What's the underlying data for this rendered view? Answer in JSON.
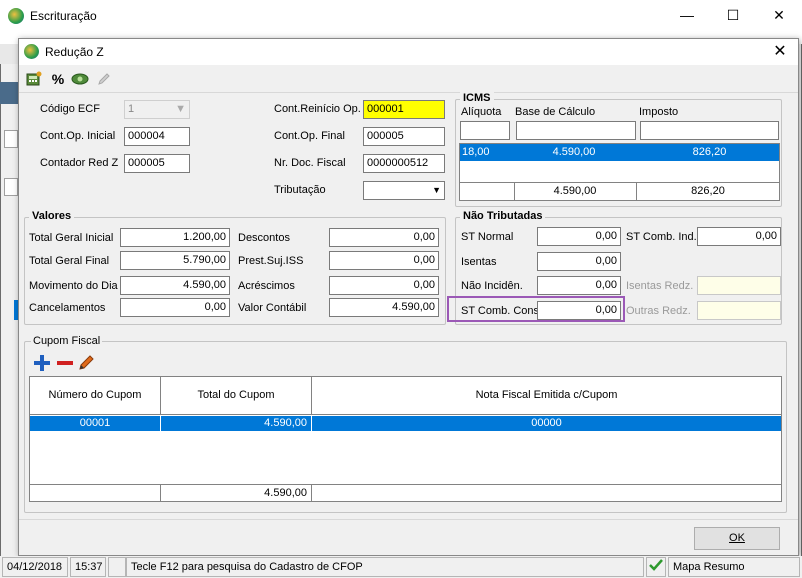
{
  "app": {
    "title": "Escrituração"
  },
  "dialog": {
    "title": "Redução Z"
  },
  "toolbar": {
    "percent_label": "%"
  },
  "header": {
    "codigo_ecf_label": "Código ECF",
    "codigo_ecf_value": "1",
    "cont_op_inicial_label": "Cont.Op. Inicial",
    "cont_op_inicial_value": "000004",
    "contador_red_z_label": "Contador Red Z",
    "contador_red_z_value": "000005",
    "cont_reinicio_label": "Cont.Reinício Op.",
    "cont_reinicio_value": "000001",
    "cont_op_final_label": "Cont.Op. Final",
    "cont_op_final_value": "000005",
    "nr_doc_fiscal_label": "Nr. Doc. Fiscal",
    "nr_doc_fiscal_value": "0000000512",
    "tributacao_label": "Tributação",
    "tributacao_value": ""
  },
  "icms": {
    "title": "ICMS",
    "columns": [
      "Alíquota",
      "Base de Cálculo",
      "Imposto"
    ],
    "rows": [
      {
        "aliquota": "18,00",
        "base": "4.590,00",
        "imposto": "826,20"
      }
    ],
    "totals": {
      "base": "4.590,00",
      "imposto": "826,20"
    }
  },
  "valores": {
    "title": "Valores",
    "total_geral_inicial_label": "Total Geral Inicial",
    "total_geral_inicial_value": "1.200,00",
    "total_geral_final_label": "Total Geral Final",
    "total_geral_final_value": "5.790,00",
    "movimento_dia_label": "Movimento do Dia",
    "movimento_dia_value": "4.590,00",
    "cancelamentos_label": "Cancelamentos",
    "cancelamentos_value": "0,00",
    "descontos_label": "Descontos",
    "descontos_value": "0,00",
    "prest_suj_iss_label": "Prest.Suj.ISS",
    "prest_suj_iss_value": "0,00",
    "acrescimos_label": "Acréscimos",
    "acrescimos_value": "0,00",
    "valor_contabil_label": "Valor Contábil",
    "valor_contabil_value": "4.590,00"
  },
  "nao_tributadas": {
    "title": "Não Tributadas",
    "st_normal_label": "ST Normal",
    "st_normal_value": "0,00",
    "isentas_label": "Isentas",
    "isentas_value": "0,00",
    "nao_inciden_label": "Não Incidên.",
    "nao_inciden_value": "0,00",
    "st_comb_cons_label": "ST Comb. Cons",
    "st_comb_cons_value": "0,00",
    "st_comb_ind_label": "ST Comb. Ind.",
    "st_comb_ind_value": "0,00",
    "isentas_redz_label": "Isentas Redz.",
    "isentas_redz_value": "",
    "outras_redz_label": "Outras Redz.",
    "outras_redz_value": ""
  },
  "cupom": {
    "title": "Cupom Fiscal",
    "columns": [
      "Número do Cupom",
      "Total do Cupom",
      "Nota Fiscal Emitida c/Cupom"
    ],
    "rows": [
      {
        "numero": "00001",
        "total": "4.590,00",
        "nota": "00000"
      }
    ],
    "total": "4.590,00"
  },
  "buttons": {
    "ok_label": "OK"
  },
  "status": {
    "date": "04/12/2018",
    "time": "15:37",
    "message": "Tecle F12 para pesquisa do Cadastro de CFOP",
    "mode": "Mapa Resumo"
  },
  "colors": {
    "highlight_border": "#9b59b6",
    "selection": "#0078d7",
    "required_field": "#ffff00"
  }
}
